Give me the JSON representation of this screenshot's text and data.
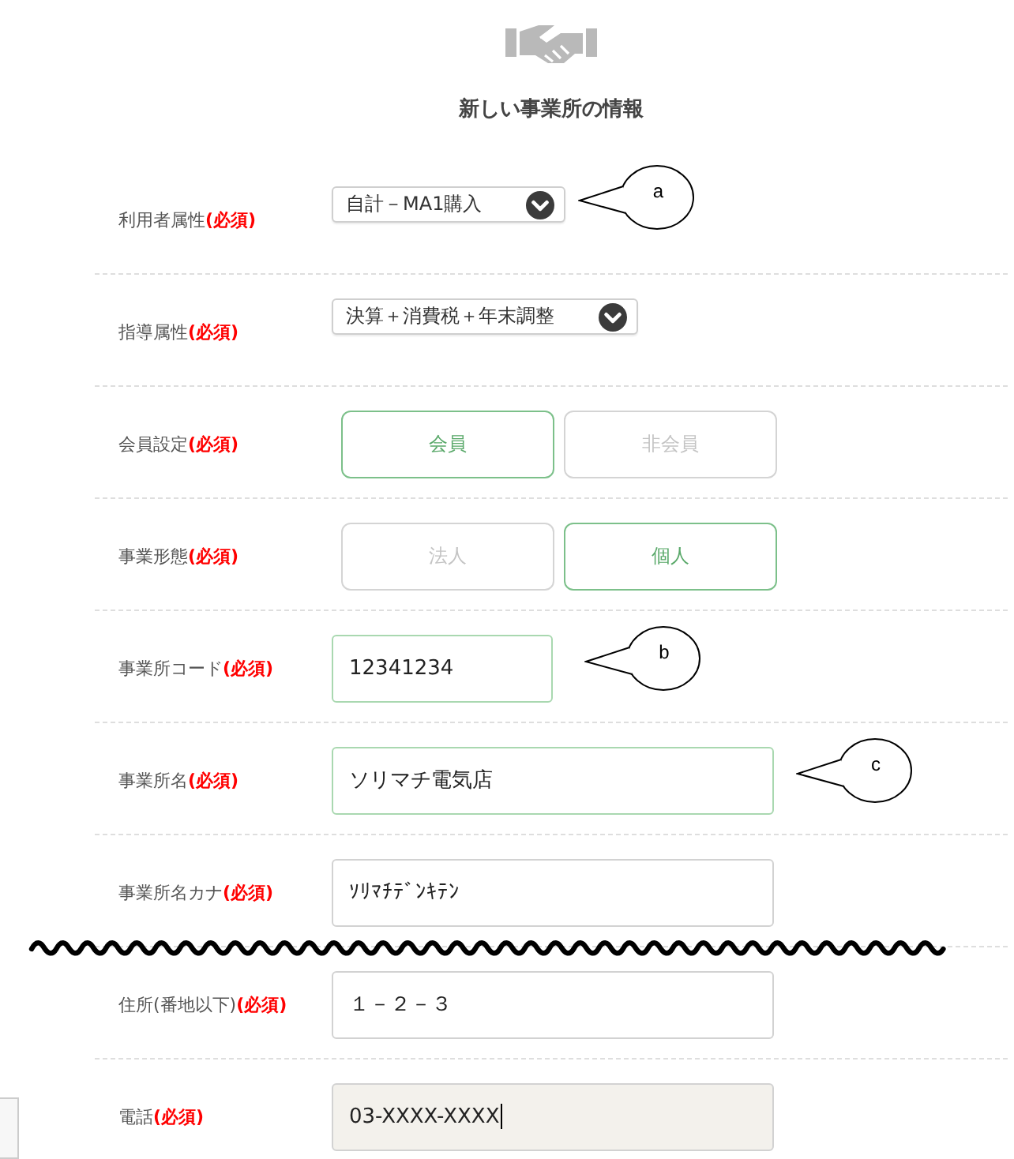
{
  "header": {
    "title": "新しい事業所の情報"
  },
  "fields": [
    {
      "kind": "select",
      "label": "利用者属性**(必須)**",
      "value": "自計－MA1購入",
      "callout": "a"
    },
    {
      "kind": "select",
      "label": "指導属性**(必須)**",
      "value": "決算＋消費税＋年末調整"
    },
    {
      "kind": "toggle",
      "label": "会員設定**(必須)**",
      "options": [
        {
          "label": "会員",
          "selected": true
        },
        {
          "label": "非会員",
          "selected": false
        }
      ]
    },
    {
      "kind": "toggle",
      "label": "事業形態**(必須)**",
      "options": [
        {
          "label": "法人",
          "selected": false
        },
        {
          "label": "個人",
          "selected": true
        }
      ]
    },
    {
      "kind": "short_text",
      "label": "事業所コード**(必須)**",
      "value": "12341234",
      "valid": true,
      "focused": false,
      "callout": "b"
    },
    {
      "kind": "text",
      "label": "事業所名**(必須)**",
      "value": "ソリマチ電気店",
      "valid": true,
      "focused": false,
      "callout": "c"
    },
    {
      "kind": "text",
      "label": "事業所名カナ**(必須)**",
      "value": "ｿﾘﾏﾁﾃﾞﾝｷﾃﾝ",
      "valid": false,
      "focused": false
    },
    {
      "kind": "break"
    },
    {
      "kind": "text",
      "label": "住所(番地以下)**(必須)**",
      "value": "１－２－３",
      "valid": false,
      "focused": false
    },
    {
      "kind": "text",
      "label": "電話**(必須)**",
      "value": "03-XXXX-XXXX",
      "valid": false,
      "focused": true
    }
  ]
}
